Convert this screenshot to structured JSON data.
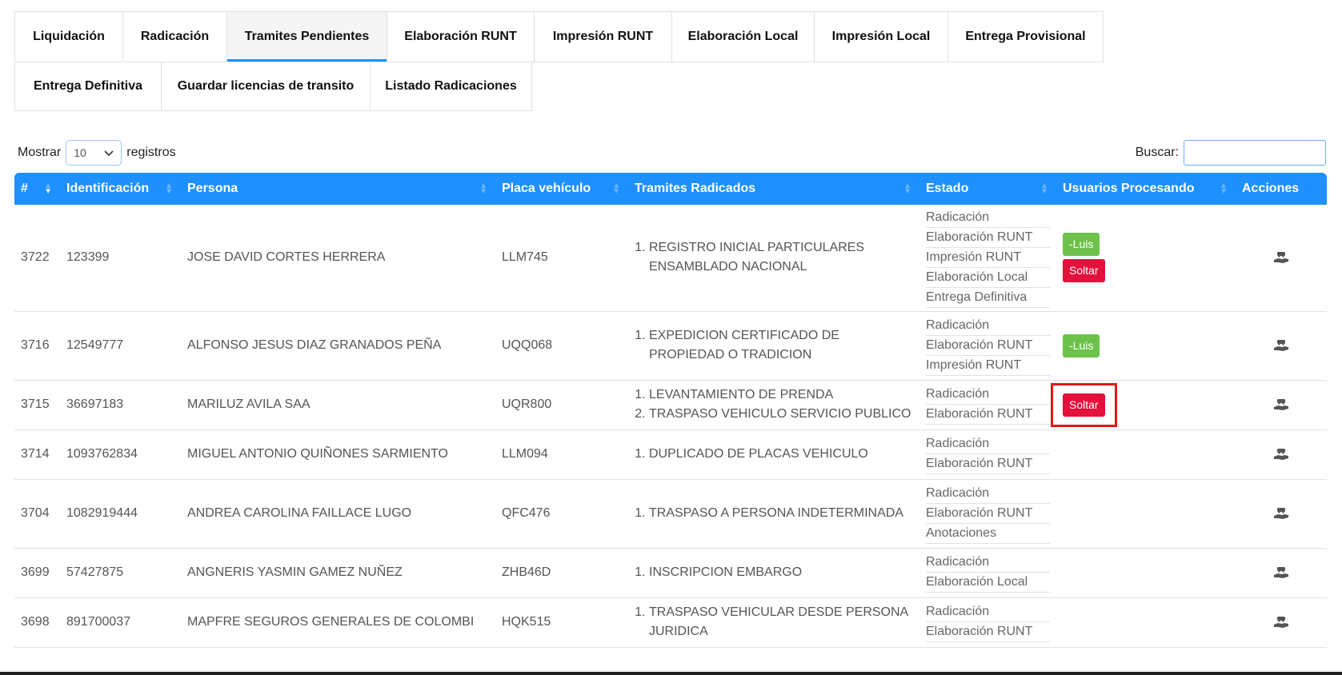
{
  "tabs_row1": [
    {
      "label": "Liquidación",
      "active": false
    },
    {
      "label": "Radicación",
      "active": false
    },
    {
      "label": "Tramites Pendientes",
      "active": true
    },
    {
      "label": "Elaboración RUNT",
      "active": false
    },
    {
      "label": "Impresión RUNT",
      "active": false
    },
    {
      "label": "Elaboración Local",
      "active": false
    },
    {
      "label": "Impresión Local",
      "active": false
    },
    {
      "label": "Entrega Provisional",
      "active": false
    }
  ],
  "tabs_row2": [
    {
      "label": "Entrega Definitiva",
      "active": false
    },
    {
      "label": "Guardar licencias de transito",
      "active": false
    },
    {
      "label": "Listado Radicaciones",
      "active": false
    }
  ],
  "controls": {
    "show_label": "Mostrar",
    "show_value": "10",
    "records_label": "registros",
    "search_label": "Buscar:",
    "search_value": ""
  },
  "table": {
    "headers": [
      "#",
      "Identificación",
      "Persona",
      "Placa vehículo",
      "Tramites Radicados",
      "Estado",
      "Usuarios Procesando",
      "Acciones"
    ],
    "rows": [
      {
        "id": "3722",
        "identificacion": "123399",
        "persona": "JOSE DAVID CORTES HERRERA",
        "placa": "LLM745",
        "tramites": [
          "REGISTRO INICIAL PARTICULARES ENSAMBLADO NACIONAL"
        ],
        "estado": [
          "Radicación",
          "Elaboración RUNT",
          "Impresión RUNT",
          "Elaboración Local",
          "Entrega Definitiva"
        ],
        "usuario": "-Luis",
        "soltar": "Soltar"
      },
      {
        "id": "3716",
        "identificacion": "12549777",
        "persona": "ALFONSO JESUS DIAZ GRANADOS PEÑA",
        "placa": "UQQ068",
        "tramites": [
          "EXPEDICION CERTIFICADO DE PROPIEDAD O TRADICION"
        ],
        "estado": [
          "Radicación",
          "Elaboración RUNT",
          "Impresión RUNT"
        ],
        "usuario": "-Luis",
        "soltar": ""
      },
      {
        "id": "3715",
        "identificacion": "36697183",
        "persona": "MARILUZ AVILA SAA",
        "placa": "UQR800",
        "tramites": [
          "LEVANTAMIENTO DE PRENDA",
          "TRASPASO VEHICULO SERVICIO PUBLICO"
        ],
        "estado": [
          "Radicación",
          "Elaboración RUNT"
        ],
        "usuario": "",
        "soltar": "Soltar",
        "highlight": true
      },
      {
        "id": "3714",
        "identificacion": "1093762834",
        "persona": "MIGUEL ANTONIO QUIÑONES SARMIENTO",
        "placa": "LLM094",
        "tramites": [
          "DUPLICADO DE PLACAS VEHICULO"
        ],
        "estado": [
          "Radicación",
          "Elaboración RUNT"
        ],
        "usuario": "",
        "soltar": ""
      },
      {
        "id": "3704",
        "identificacion": "1082919444",
        "persona": "ANDREA CAROLINA FAILLACE LUGO",
        "placa": "QFC476",
        "tramites": [
          "TRASPASO A PERSONA INDETERMINADA"
        ],
        "estado": [
          "Radicación",
          "Elaboración RUNT",
          "Anotaciones"
        ],
        "usuario": "",
        "soltar": ""
      },
      {
        "id": "3699",
        "identificacion": "57427875",
        "persona": "ANGNERIS YASMIN GAMEZ NUÑEZ",
        "placa": "ZHB46D",
        "tramites": [
          "INSCRIPCION EMBARGO"
        ],
        "estado": [
          "Radicación",
          "Elaboración Local"
        ],
        "usuario": "",
        "soltar": ""
      },
      {
        "id": "3698",
        "identificacion": "891700037",
        "persona": "MAPFRE SEGUROS GENERALES DE COLOMBI",
        "placa": "HQK515",
        "tramites": [
          "TRASPASO VEHICULAR DESDE PERSONA JURIDICA"
        ],
        "estado": [
          "Radicación",
          "Elaboración RUNT"
        ],
        "usuario": "",
        "soltar": ""
      }
    ]
  },
  "icons": {
    "action": "hand-holding-car-icon",
    "sort": "sort-arrows-icon",
    "dropdown": "chevron-down-icon"
  },
  "colors": {
    "header_bg": "#1e90ff",
    "user_badge": "#6cc24a",
    "release_badge": "#e3113b",
    "highlight": "#e01818"
  }
}
